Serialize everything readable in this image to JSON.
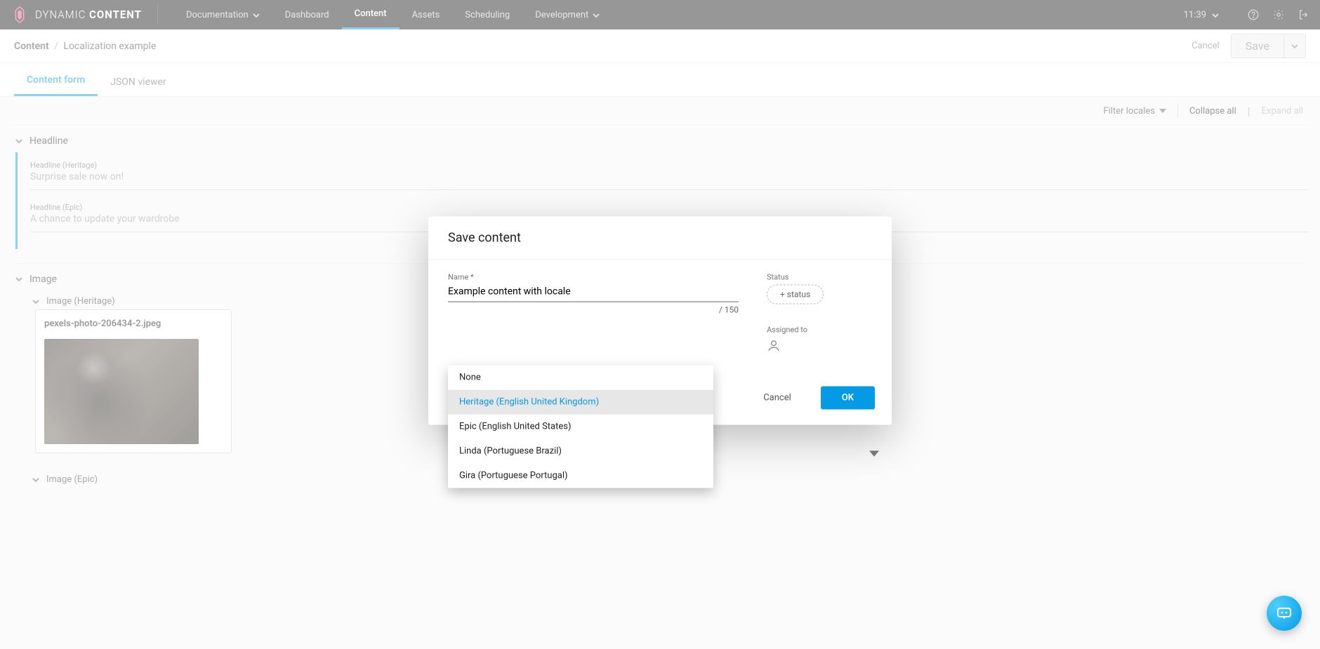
{
  "brand": {
    "name_light": "DYNAMIC",
    "name_bold": "CONTENT"
  },
  "topnav": {
    "doc": "Documentation",
    "dashboard": "Dashboard",
    "content": "Content",
    "assets": "Assets",
    "scheduling": "Scheduling",
    "development": "Development"
  },
  "clock": "11:39",
  "breadcrumb": {
    "root": "Content",
    "current": "Localization example"
  },
  "toolbar": {
    "cancel": "Cancel",
    "save": "Save"
  },
  "tabs": {
    "form": "Content form",
    "json": "JSON viewer"
  },
  "form_toolbar": {
    "filter": "Filter locales",
    "collapse": "Collapse all",
    "expand": "Expand all",
    "sep": "|"
  },
  "form": {
    "headline": {
      "section": "Headline",
      "heritage_label": "Headline (Heritage)",
      "heritage_value": "Surprise sale now on!",
      "epic_label": "Headline (Epic)",
      "epic_value": "A chance to update your wardrobe"
    },
    "image": {
      "section": "Image",
      "heritage_label": "Image (Heritage)",
      "heritage_file": "pexels-photo-206434-2.jpeg",
      "epic_label": "Image (Epic)"
    }
  },
  "modal": {
    "title": "Save content",
    "name_label": "Name *",
    "name_value": "Example content with locale",
    "name_count": "/ 150",
    "status_label": "Status",
    "status_chip": "+ status",
    "assigned_label": "Assigned to",
    "cancel": "Cancel",
    "ok": "OK"
  },
  "locale_dropdown": {
    "items": [
      "None",
      "Heritage (English United Kingdom)",
      "Epic (English United States)",
      "Linda (Portuguese Brazil)",
      "Gira (Portuguese Portugal)"
    ],
    "selected_index": 1
  }
}
